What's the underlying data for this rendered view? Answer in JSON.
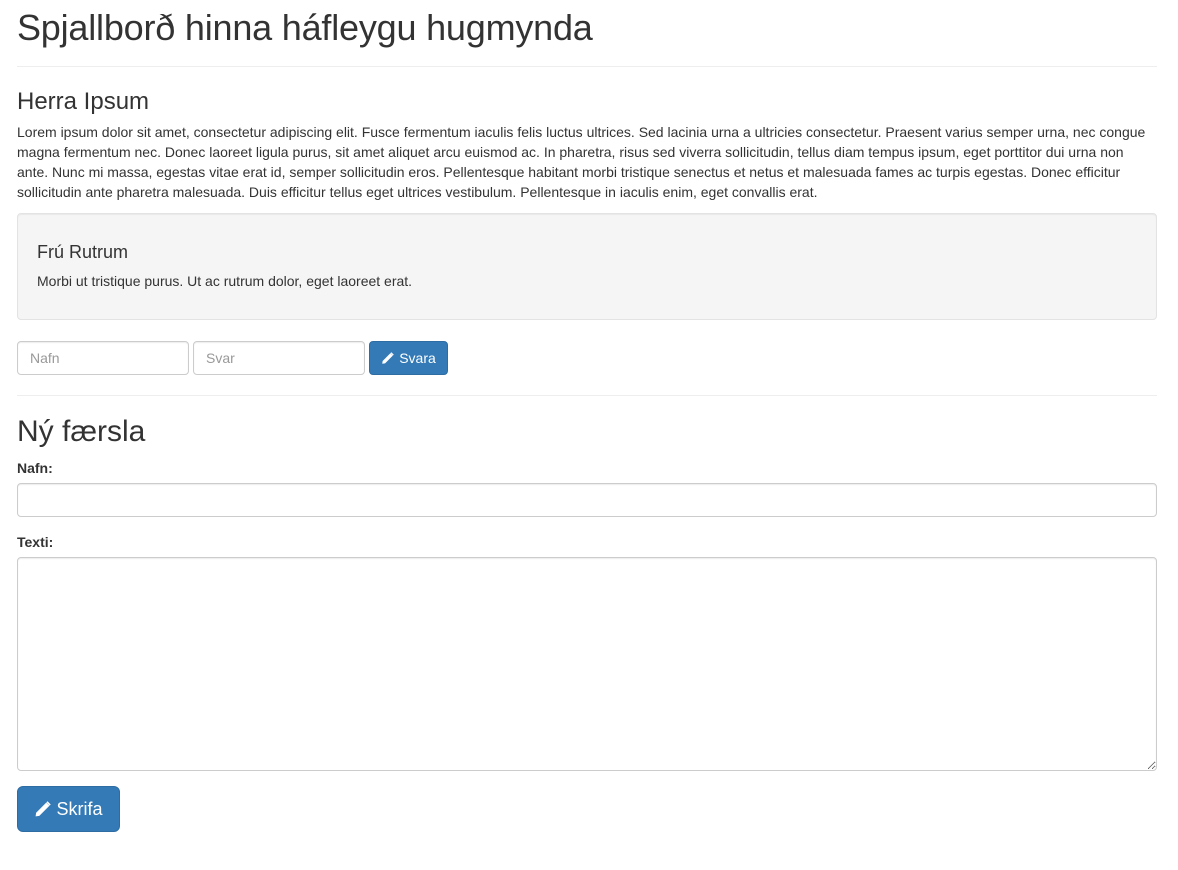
{
  "page": {
    "title": "Spjallborð hinna háfleygu hugmynda"
  },
  "post": {
    "author": "Herra Ipsum",
    "text": "Lorem ipsum dolor sit amet, consectetur adipiscing elit. Fusce fermentum iaculis felis luctus ultrices. Sed lacinia urna a ultricies consectetur. Praesent varius semper urna, nec congue magna fermentum nec. Donec laoreet ligula purus, sit amet aliquet arcu euismod ac. In pharetra, risus sed viverra sollicitudin, tellus diam tempus ipsum, eget porttitor dui urna non ante. Nunc mi massa, egestas vitae erat id, semper sollicitudin eros. Pellentesque habitant morbi tristique senectus et netus et malesuada fames ac turpis egestas. Donec efficitur sollicitudin ante pharetra malesuada. Duis efficitur tellus eget ultrices vestibulum. Pellentesque in iaculis enim, eget convallis erat.",
    "reply": {
      "author": "Frú Rutrum",
      "text": "Morbi ut tristique purus. Ut ac rutrum dolor, eget laoreet erat."
    },
    "reply_form": {
      "name_placeholder": "Nafn",
      "name_value": "",
      "answer_placeholder": "Svar",
      "answer_value": "",
      "button_label": "Svara",
      "button_icon": "pencil-icon"
    }
  },
  "new_post": {
    "title": "Ný færsla",
    "name_label": "Nafn:",
    "name_value": "",
    "text_label": "Texti:",
    "text_value": "",
    "submit_label": "Skrifa",
    "submit_icon": "pencil-icon"
  },
  "colors": {
    "primary": "#337ab7",
    "primary_border": "#2e6da4",
    "text": "#333333",
    "well_bg": "#f5f5f5",
    "divider": "#eeeeee"
  }
}
